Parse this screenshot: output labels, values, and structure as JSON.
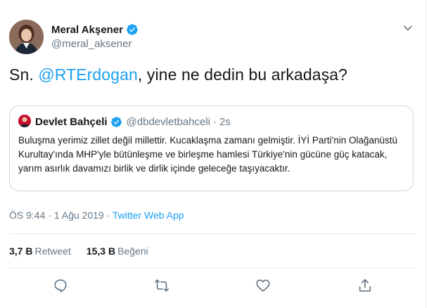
{
  "author": {
    "name": "Meral Akşener",
    "handle": "@meral_aksener"
  },
  "tweet": {
    "prefix": "Sn. ",
    "mention": "@RTErdogan",
    "suffix": ", yine ne dedin bu arkadaşa?"
  },
  "quote": {
    "name": "Devlet Bahçeli",
    "handle": "@dbdevletbahceli",
    "separator": "·",
    "time": "2s",
    "text": "Buluşma yerimiz zillet değil millettir. Kucaklaşma zamanı gelmiştir. İYİ Parti'nin Olağanüstü Kurultay'ında MHP'yle bütünleşme ve birleşme hamlesi Türkiye'nin gücüne güç katacak, yarım asırlık davamızı birlik ve dirlik içinde geleceğe taşıyacaktır."
  },
  "meta": {
    "time": "ÖS 9:44",
    "separator1": " · ",
    "date": "1 Ağu 2019",
    "separator2": " · ",
    "source": "Twitter Web App"
  },
  "stats": {
    "retweets_count": "3,7 B",
    "retweets_label": "Retweet",
    "likes_count": "15,3 B",
    "likes_label": "Beğeni"
  },
  "icons": {
    "verified": "verified-badge-icon",
    "caret": "chevron-down-icon",
    "reply": "reply-icon",
    "retweet": "retweet-icon",
    "like": "heart-icon",
    "share": "share-icon"
  },
  "colors": {
    "accent": "#1da1f2",
    "secondary_text": "#657786",
    "border": "#e6ecf0"
  }
}
